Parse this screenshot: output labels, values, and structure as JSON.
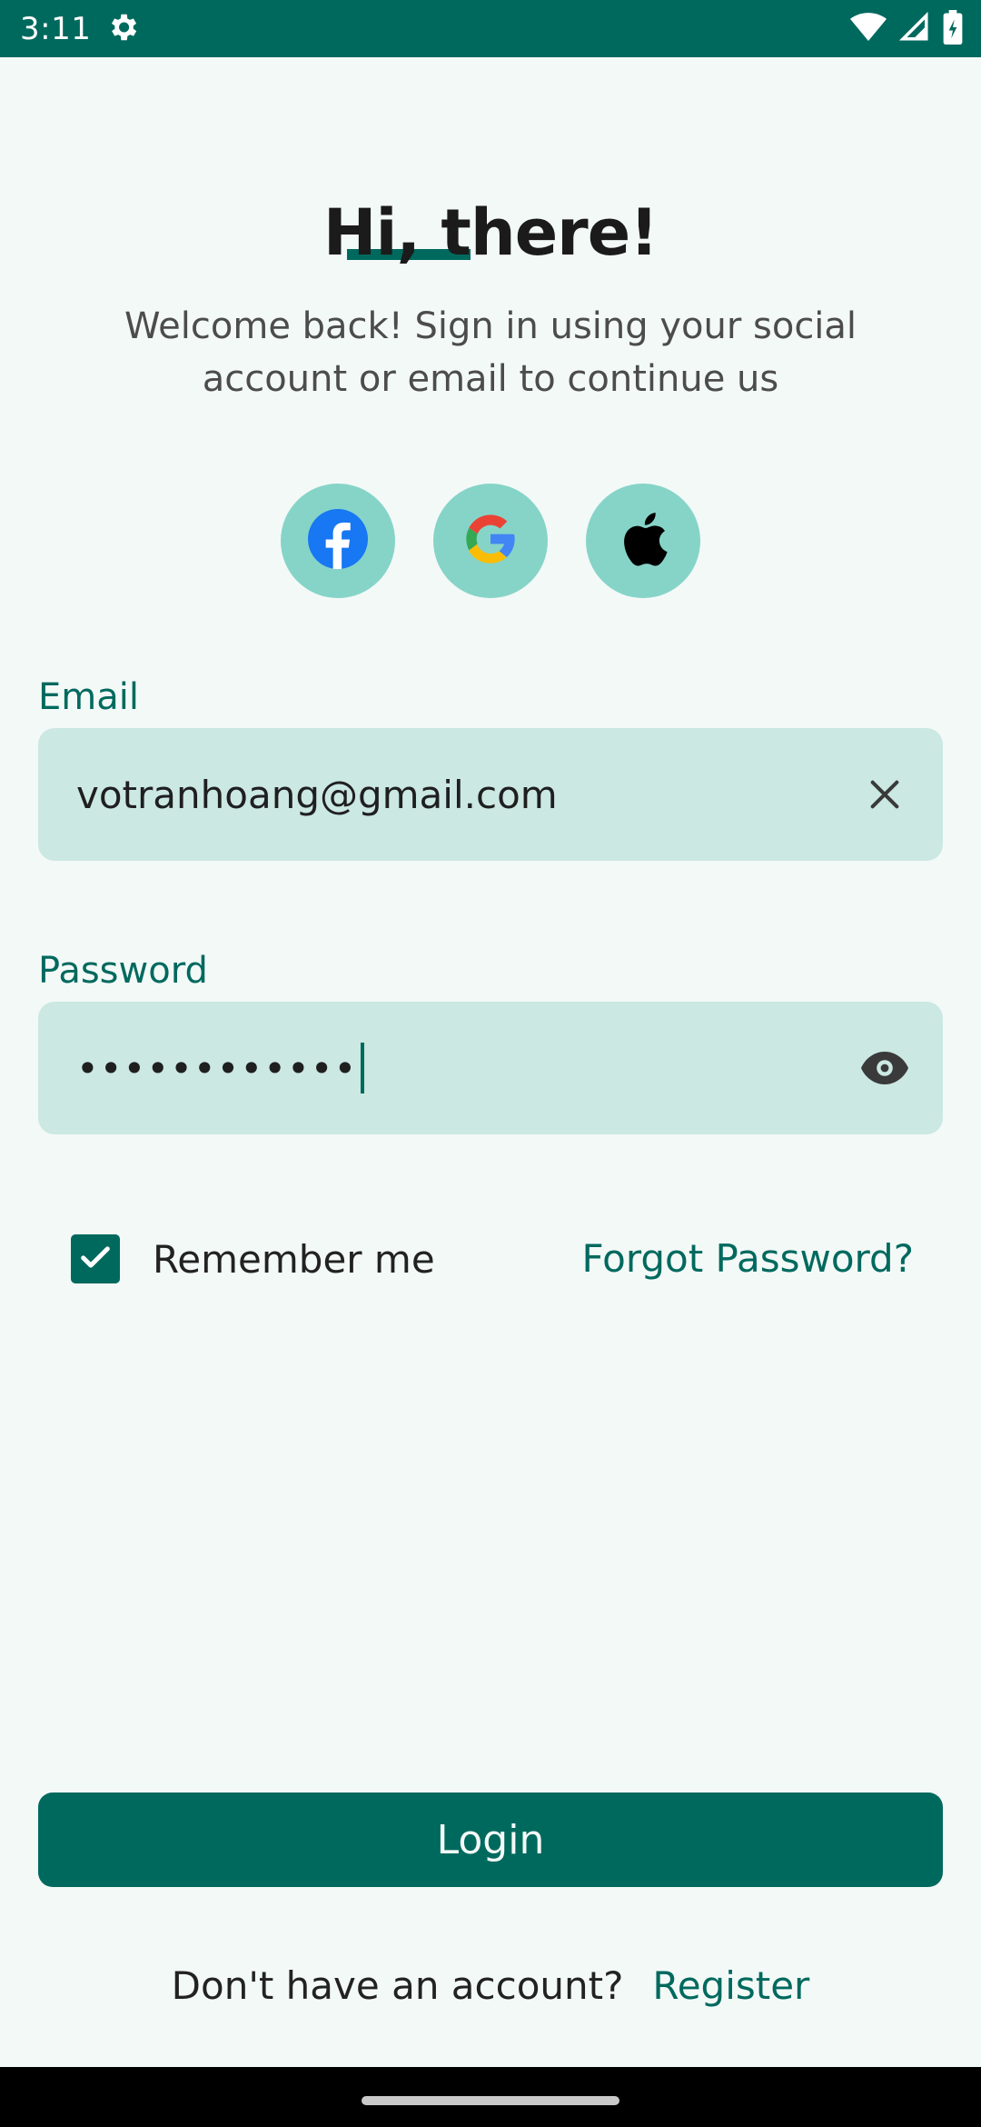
{
  "status_bar": {
    "time": "3:11"
  },
  "header": {
    "title": "Hi, there!",
    "subtitle": "Welcome back! Sign in using your social account or email to continue us"
  },
  "colors": {
    "primary": "#00695e",
    "background": "#f3f9f7",
    "field_background": "#cbe8e2",
    "social_button": "#86d4c8"
  },
  "social": [
    {
      "icon": "facebook-icon"
    },
    {
      "icon": "google-icon"
    },
    {
      "icon": "apple-icon"
    }
  ],
  "form": {
    "email_label": "Email",
    "email_value": "votranhoang@gmail.com",
    "password_label": "Password",
    "password_value": "••••••••••••",
    "remember_label": "Remember me",
    "remember_checked": true,
    "forgot_label": "Forgot Password?"
  },
  "actions": {
    "login_label": "Login",
    "register_prompt": "Don't have an account?",
    "register_label": "Register"
  }
}
